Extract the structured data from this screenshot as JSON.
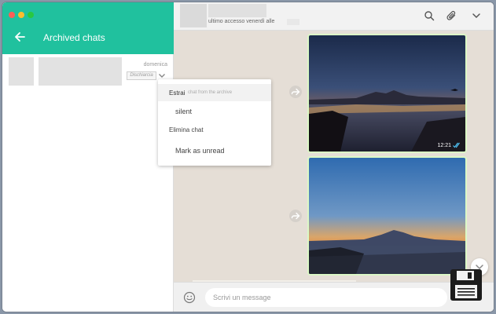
{
  "sidebar": {
    "title": "Archived chats",
    "chat": {
      "day": "domenica",
      "badge": "Dischiarcia"
    }
  },
  "context_menu": {
    "items": [
      {
        "label": "Estrai",
        "overlay": "chat from the archive"
      },
      {
        "label": "silent"
      },
      {
        "label": "Elimina chat"
      },
      {
        "label": "Mark as unread"
      }
    ]
  },
  "chat_header": {
    "status": "ultimo accesso venerdì alle"
  },
  "messages": [
    {
      "time": "12:21"
    },
    {
      "time": ""
    }
  ],
  "composer": {
    "placeholder": "Scrivi un message"
  },
  "colors": {
    "accent": "#20c19e",
    "chat_bg": "#e5ded6",
    "bubble_out": "#dcf8c6",
    "tick_blue": "#4fc3f7"
  },
  "icons": [
    "back-arrow-icon",
    "chevron-down-icon",
    "forward-icon",
    "search-icon",
    "attach-icon",
    "menu-chevron-icon",
    "emoji-icon",
    "save-icon",
    "double-tick-icon"
  ]
}
